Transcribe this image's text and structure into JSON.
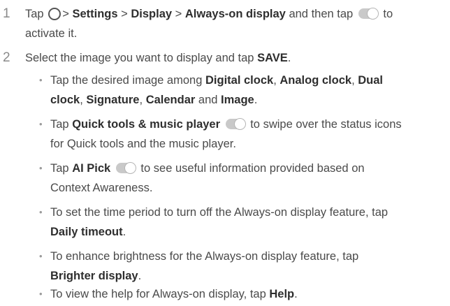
{
  "step1": {
    "number": "1",
    "tap": "Tap",
    "gt1": ">",
    "settings": "Settings",
    "gt2": ">",
    "display": "Display",
    "gt3": ">",
    "always_on": "Always-on display",
    "then_tap": "and then tap",
    "to": "to",
    "activate": "activate it."
  },
  "step2": {
    "number": "2",
    "text_a": "Select the image you want to display and tap",
    "save": "SAVE",
    "period": "."
  },
  "bullets": {
    "dot": "•",
    "b1": {
      "a": "Tap the desired image among",
      "digital": "Digital clock",
      "c1": ",",
      "analog": "Analog clock",
      "c2": ",",
      "dual1": "Dual",
      "dual2": "clock",
      "c3": ",",
      "signature": "Signature",
      "c4": ",",
      "calendar": "Calendar",
      "and": "and",
      "image": "Image",
      "end": "."
    },
    "b2": {
      "tap": "Tap",
      "quick": "Quick tools & music player",
      "a": "to swipe over the status icons",
      "b": "for Quick tools and the music player."
    },
    "b3": {
      "tap": "Tap",
      "ai": "AI Pick",
      "a": "to see useful information provided based on",
      "b": "Context Awareness."
    },
    "b4": {
      "a": "To set the time period to turn off the Always-on display feature, tap",
      "daily": "Daily timeout",
      "end": "."
    },
    "b5": {
      "a": "To enhance brightness for the Always-on display feature, tap",
      "brighter": "Brighter display",
      "end": "."
    },
    "b6": {
      "a": "To view the help for Always-on display, tap",
      "help": "Help",
      "end": "."
    }
  },
  "icons": {
    "home": "home-circle-icon",
    "toggle": "toggle-switch-icon"
  }
}
